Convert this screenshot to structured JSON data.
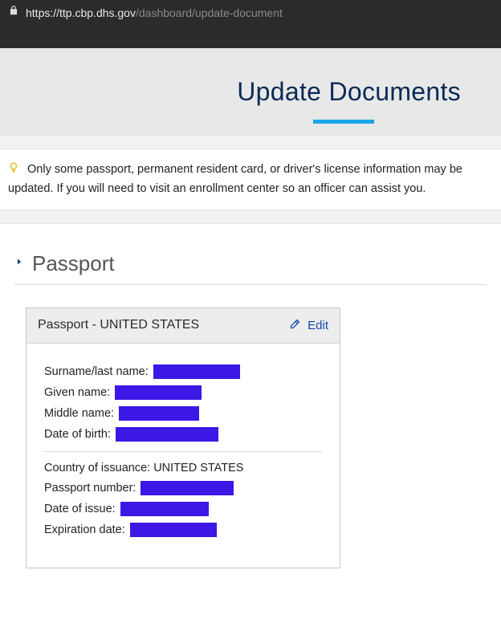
{
  "address": {
    "host": "https://ttp.cbp.dhs.gov",
    "path": "/dashboard/update-document"
  },
  "banner": {
    "title": "Update Documents"
  },
  "info": {
    "text": "Only some passport, permanent resident card, or driver's license information may be updated. If you will need to visit an enrollment center so an officer can assist you."
  },
  "section": {
    "title": "Passport"
  },
  "card": {
    "title": "Passport - UNITED STATES",
    "edit": "Edit",
    "rows1": {
      "surname": "Surname/last name:",
      "given": "Given name:",
      "middle": "Middle name:",
      "dob": "Date of birth:"
    },
    "rows2": {
      "country_label": "Country of issuance:",
      "country_value": "UNITED STATES",
      "passnum": "Passport number:",
      "doi": "Date of issue:",
      "exp": "Expiration date:"
    }
  }
}
